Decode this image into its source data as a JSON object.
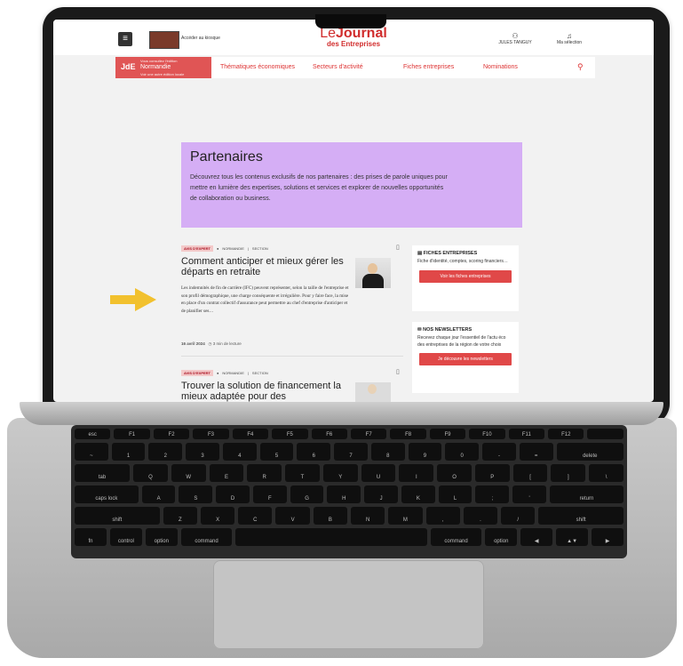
{
  "header": {
    "kiosk_link": "Accéder au kiosque",
    "logo_line1_prefix": "Le",
    "logo_line1_main": "Journal",
    "logo_line2": "des Entreprises",
    "user_name": "JULES TANGUY",
    "selection_label": "Ma sélection"
  },
  "region": {
    "badge": "JdE",
    "edition_label": "Vous consultez l'édition",
    "name": "Normandie",
    "other_edition": "Voir une autre édition locale"
  },
  "nav": {
    "items": [
      "Thématiques économiques",
      "Secteurs d'activité",
      "Fiches entreprises",
      "Nominations"
    ]
  },
  "hero": {
    "title": "Partenaires",
    "text": "Découvrez tous les contenus exclusifs de nos partenaires : des prises de parole uniques pour mettre en lumière des expertises, solutions et services et explorer de nouvelles opportunités de collaboration ou business."
  },
  "articles": [
    {
      "tag": "AVIS D'EXPERT",
      "region": "NORMANDIE",
      "section": "SECTION",
      "title": "Comment anticiper et mieux gérer les départs en retraite",
      "excerpt": "Les indemnités de fin de carrière (IFC) peuvent représenter, selon la taille de l'entreprise et son profil démographique, une charge conséquente et irrégulière. Pour y faire face, la mise en place d'un contrat collectif d'assurance peut permettre au chef d'entreprise d'anticiper et de planifier ses…",
      "date": "16 avril 2024",
      "read_time": "3 min de lecture"
    },
    {
      "tag": "AVIS D'EXPERT",
      "region": "NORMANDIE",
      "section": "SECTION",
      "title": "Trouver la solution de financement la mieux adaptée pour des"
    }
  ],
  "sidebar": {
    "fiches": {
      "title": "FICHES ENTREPRISES",
      "text": "Fiche d'identité, comptes, scoring financiers…",
      "button": "Voir les fiches entreprises"
    },
    "newsletters": {
      "title": "NOS NEWSLETTERS",
      "text": "Recevez chaque jour l'essentiel de l'actu éco des entreprises de la région de votre choix",
      "button": "Je découvre les newsletters"
    }
  },
  "keyboard": {
    "row1": [
      "esc",
      "F1",
      "F2",
      "F3",
      "F4",
      "F5",
      "F6",
      "F7",
      "F8",
      "F9",
      "F10",
      "F11",
      "F12",
      ""
    ],
    "row2": [
      "~",
      "1",
      "2",
      "3",
      "4",
      "5",
      "6",
      "7",
      "8",
      "9",
      "0",
      "-",
      "=",
      "delete"
    ],
    "row3": [
      "tab",
      "Q",
      "W",
      "E",
      "R",
      "T",
      "Y",
      "U",
      "I",
      "O",
      "P",
      "[",
      "]",
      "\\"
    ],
    "row4": [
      "caps lock",
      "A",
      "S",
      "D",
      "F",
      "G",
      "H",
      "J",
      "K",
      "L",
      ";",
      "'",
      "return"
    ],
    "row5": [
      "shift",
      "Z",
      "X",
      "C",
      "V",
      "B",
      "N",
      "M",
      ",",
      ".",
      "/",
      "shift"
    ],
    "row6": [
      "fn",
      "control",
      "option",
      "command",
      "",
      "command",
      "option",
      "◀",
      "▲▼",
      "▶"
    ]
  },
  "colors": {
    "accent": "#e05555",
    "hero_bg": "#d5aef5",
    "arrow": "#f2c12e"
  }
}
